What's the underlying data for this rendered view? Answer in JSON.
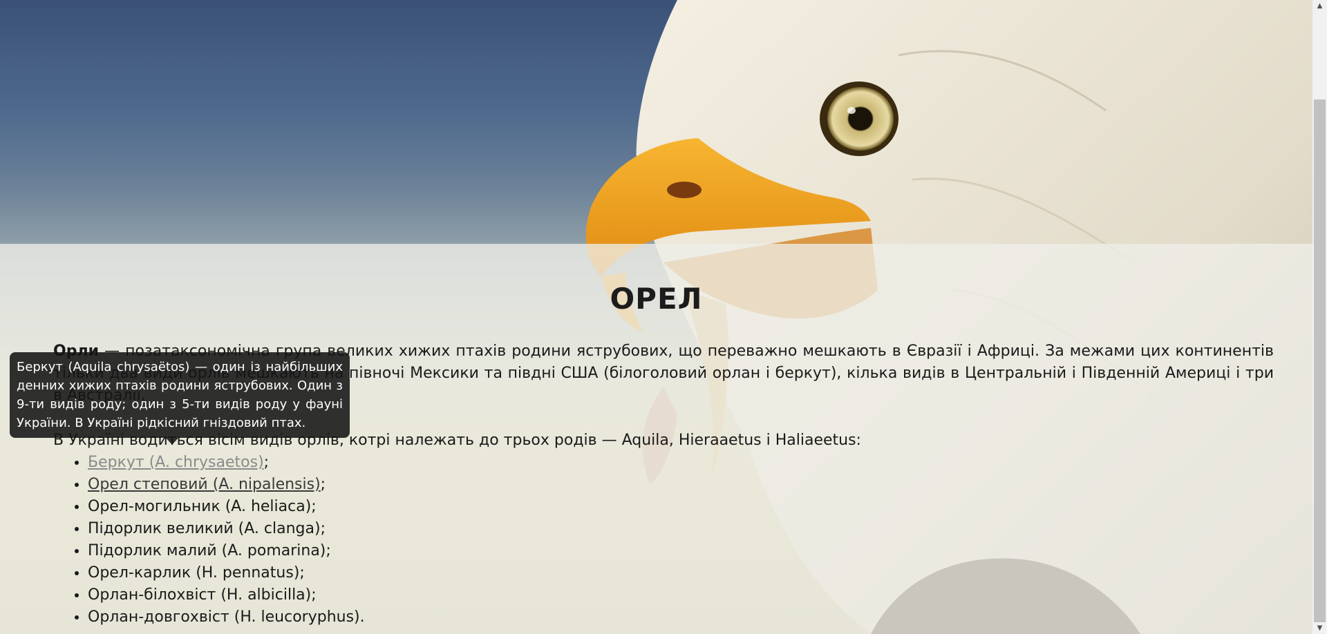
{
  "page": {
    "title": "ОРЕЛ"
  },
  "intro": {
    "bold_term": "Орли",
    "text": " — позатаксономічна група великих хижих птахів родини яструбових, що переважно мешкають в Євразії і Африці. За межами цих континентів тільки два види орлів мешкають на півночі Мексики та півдні США (білоголовий орлан і беркут), кілька видів в Центральній і Південній Америці і три в Австралії."
  },
  "ukraine_intro": "В Україні водиться вісім видів орлів, котрі належать до трьох родів — Aquila, Hieraaetus і Haliaeetus:",
  "species": [
    {
      "label": "Беркут (A. chrysaetos)",
      "suffix": ";"
    },
    {
      "label": "Орел степовий (A. nipalensis)",
      "suffix": ";"
    },
    {
      "label": "Орел-могильник (A. heliaca);"
    },
    {
      "label": "Підорлик великий (A. clanga);"
    },
    {
      "label": "Підорлик малий (A. pomarina);"
    },
    {
      "label": "Орел-карлик (H. pennatus);"
    },
    {
      "label": "Орлан-білохвіст (H. albicilla);"
    },
    {
      "label": "Орлан-довгохвіст (H. leucoryphus)."
    }
  ],
  "tooltip": {
    "text": "Беркут (Aquila chrysaëtos) — один із найбільших денних хижих птахів родини яструбових. Один з 9-ти видів роду; один з 5-ти видів роду у фауні України. В Україні рідкісний гніздовий птах."
  },
  "icons": {
    "scroll_up": "triangle-up-icon",
    "scroll_down": "triangle-down-icon"
  },
  "colors": {
    "overlay": "#eeeee8",
    "tooltip_bg": "#141414",
    "beak": "#f0a423",
    "sky": "#3b5178"
  }
}
